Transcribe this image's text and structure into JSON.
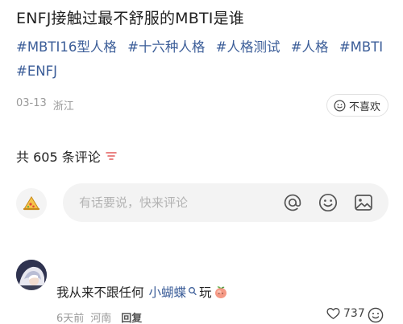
{
  "post": {
    "title": "ENFJ接触过最不舒服的MBTI是谁",
    "tags": [
      "#MBTI16型人格",
      "#十六种人格",
      "#人格测试",
      "#人格",
      "#MBTI",
      "#ENFJ"
    ],
    "date": "03-13",
    "location": "浙江",
    "dislike_label": "不喜欢"
  },
  "comments_header": {
    "count_label": "共 605 条评论"
  },
  "comment_input": {
    "placeholder": "有话要说，快来评论"
  },
  "comments": [
    {
      "text_prefix": "我从来不跟任何",
      "mention": "小蝴蝶",
      "text_suffix": "玩",
      "time": "6天前",
      "location": "河南",
      "reply_label": "回复",
      "likes": "737"
    }
  ],
  "colors": {
    "link": "#3b5d98",
    "muted": "#9a9a9a",
    "input_bg": "#f3f3f3",
    "filter_icon": "#e35b5b"
  },
  "icons": [
    "smile-face-icon",
    "filter-icon",
    "pizza-slice-icon",
    "at-icon",
    "emoji-icon",
    "image-icon",
    "avatar",
    "search-small-icon",
    "peach-emoji-icon",
    "heart-icon",
    "face-icon"
  ]
}
